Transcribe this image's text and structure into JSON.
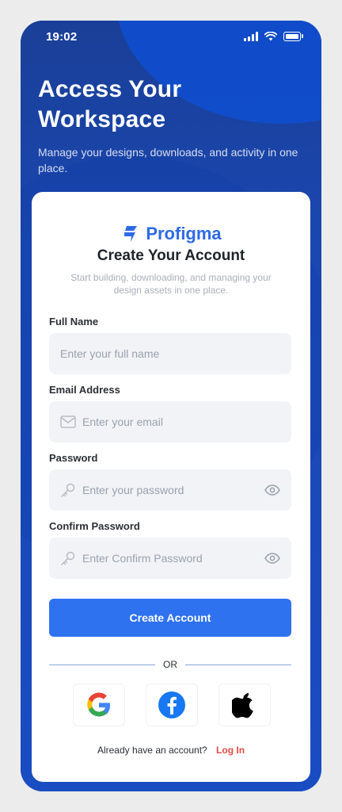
{
  "status": {
    "time": "19:02"
  },
  "hero": {
    "title_line1": "Access Your",
    "title_line2": "Workspace",
    "subtitle": "Manage your designs, downloads, and activity in one place."
  },
  "card": {
    "brand": "Profigma",
    "title": "Create Your Account",
    "subtitle": "Start building, downloading, and managing your design assets in one place.",
    "fields": {
      "full_name": {
        "label": "Full Name",
        "placeholder": "Enter your full name",
        "value": ""
      },
      "email": {
        "label": "Email Address",
        "placeholder": "Enter your email",
        "value": ""
      },
      "password": {
        "label": "Password",
        "placeholder": "Enter your password",
        "value": ""
      },
      "confirm_password": {
        "label": "Confirm Password",
        "placeholder": "Enter Confirm Password",
        "value": ""
      }
    },
    "create_button": "Create Account",
    "divider": "OR",
    "social": [
      "google",
      "facebook",
      "apple"
    ],
    "login_prompt": "Already have an account?",
    "login_link": "Log In"
  },
  "colors": {
    "primary": "#2f72f0",
    "brand": "#2f6ae5",
    "background": "#1a47b3",
    "link": "#e04a44"
  },
  "icons": {
    "email_field": "mail-icon",
    "password_field": "key-icon",
    "show_password": "eye-icon",
    "signal": "signal-icon",
    "wifi": "wifi-icon",
    "battery": "battery-icon"
  }
}
